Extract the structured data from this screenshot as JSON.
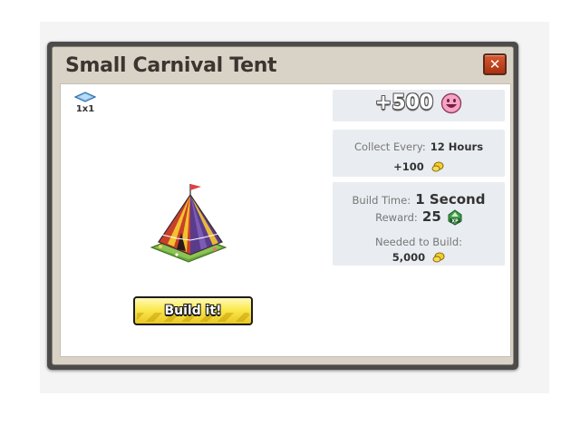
{
  "dialog": {
    "title": "Small Carnival Tent",
    "close_label": "✕"
  },
  "footprint": {
    "size_label": "1x1"
  },
  "reward": {
    "amount": "+500",
    "icon": "happiness-smile-icon"
  },
  "collect": {
    "label": "Collect Every:",
    "interval": "12 Hours",
    "coins": "+100",
    "icon": "coin-icon"
  },
  "build": {
    "time_label": "Build Time:",
    "time_value": "1 Second",
    "reward_label": "Reward:",
    "reward_value": "25",
    "reward_icon": "xp-icon",
    "needed_label": "Needed to Build:",
    "needed_value": "5,000",
    "needed_icon": "coin-icon",
    "button_label": "Build it!"
  },
  "colors": {
    "frame": "#4b4b4b",
    "title_bar": "#d9d3c7",
    "panel": "#e9ecf0",
    "button": "#fbe94f",
    "close": "#c0431f"
  }
}
